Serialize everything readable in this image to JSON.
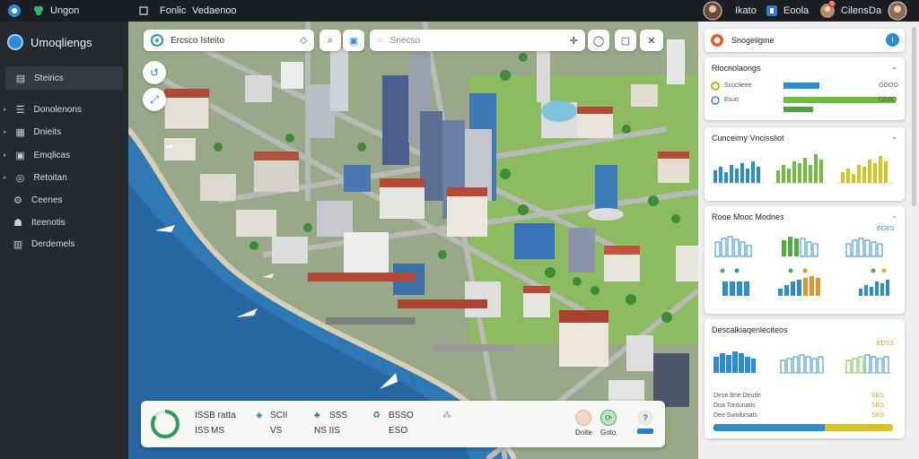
{
  "topbar": {
    "app_name": "Ungon",
    "menu_1": "Fonlic",
    "menu_2": "Vedaenoo",
    "user_1": "Ikato",
    "item_2": "Eoola",
    "item_3": "Cilens",
    "notification_count": "9",
    "item_4": "Da"
  },
  "sidebar": {
    "title": "Umoqliengs",
    "items": [
      {
        "label": "Steirics",
        "icon": "chart-icon"
      },
      {
        "label": "Donolenons",
        "icon": "list-icon"
      },
      {
        "label": "Dnieits",
        "icon": "grid-icon"
      },
      {
        "label": "Emqlicas",
        "icon": "layers-icon"
      },
      {
        "label": "Retoitan",
        "icon": "target-icon"
      },
      {
        "label": "Ceenes",
        "icon": "settings-icon"
      },
      {
        "label": "Iteenotis",
        "icon": "users-icon"
      },
      {
        "label": "Derdemels",
        "icon": "calendar-icon"
      }
    ]
  },
  "map": {
    "search_label": "Ercsco Isteito",
    "search2_placeholder": "Snecso"
  },
  "bottom": {
    "stats": [
      {
        "top": "ISSB ratta",
        "bottom": "ISS",
        "bottom_val": "MS"
      },
      {
        "top": "SCII",
        "bottom": "VS"
      },
      {
        "top": "SSS",
        "bottom": "NS IIS"
      },
      {
        "top": "BSSO",
        "bottom": "ESO"
      }
    ],
    "actions": [
      "Doite",
      "Goto"
    ]
  },
  "right": {
    "header": "Snogeligme",
    "card1": {
      "title": "Rlocnolaongs",
      "rows": [
        {
          "label": "Scoctieee",
          "value": "GGOO",
          "fill": 0.32
        },
        {
          "label": "Esuo",
          "value": "GEBO",
          "fill": 1.0
        },
        {
          "label": "",
          "value": "",
          "fill": 0.28
        }
      ]
    },
    "card2": {
      "title": "Cunceimy Vncissliot"
    },
    "card3": {
      "title": "Rooe Mooc Modnes",
      "val": "EGES"
    },
    "card4": {
      "title": "Descalkiaqenleciteos",
      "val": "EDSS",
      "rows": [
        {
          "label": "Dese Bne Deutle",
          "value": "SBS"
        },
        {
          "label": "Doa Tontunatis",
          "value": "SBS"
        },
        {
          "label": "Dee Swolbrsats",
          "value": "SBS"
        }
      ]
    }
  },
  "colors": {
    "blue": "#2a8dd2",
    "green": "#6bbf3a",
    "yellow": "#d6c323",
    "dark": "#1b1e22"
  }
}
